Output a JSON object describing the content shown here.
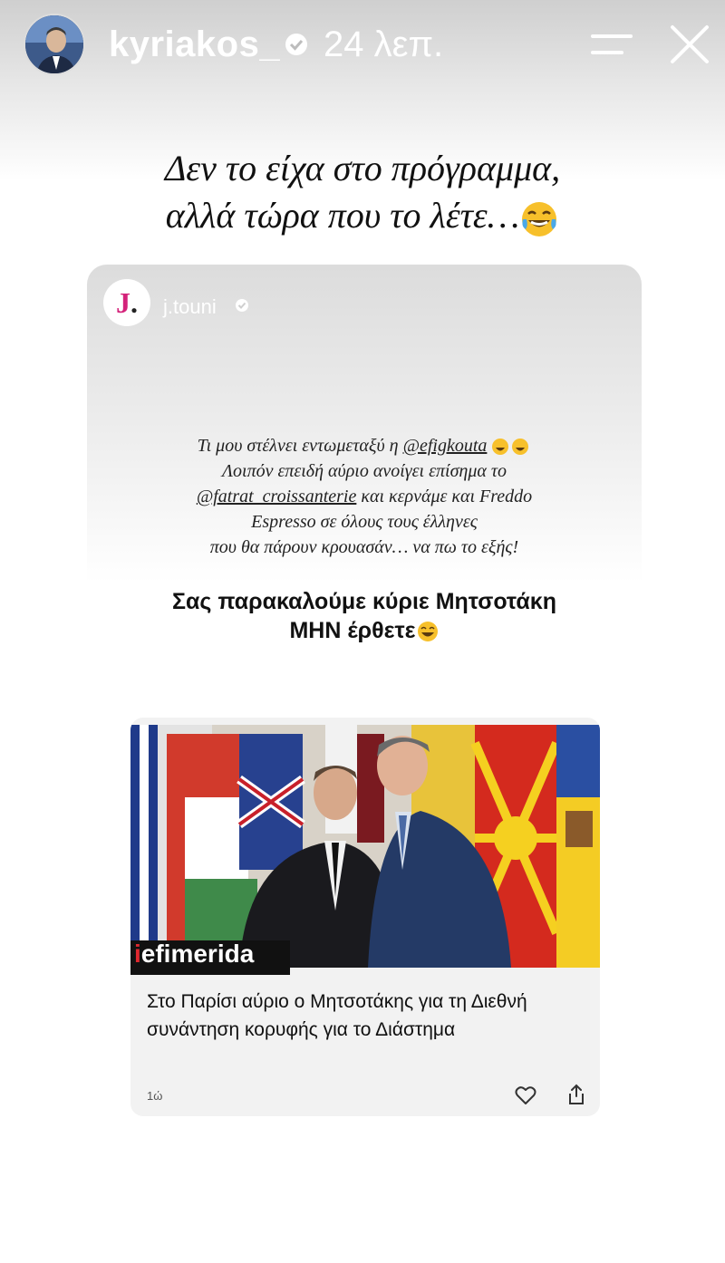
{
  "header": {
    "username": "kyriakos_",
    "time": "24 λεπ."
  },
  "caption": {
    "line1": "Δεν το είχα στο πρόγραμμα,",
    "line2": "αλλά τώρα που το λέτε…",
    "emoji": "face-with-tears-of-joy"
  },
  "repost": {
    "logo_letter": "J",
    "account": "j.touni",
    "text": {
      "l1_a": "Τι μου στέλνει εντωμεταξύ η ",
      "l1_mention": "@efigkouta",
      "l2": "Λοιπόν επειδή αύριο ανοίγει επίσημα το",
      "l3_mention": "@fatrat_croissanterie",
      "l3_b": " και κερνάμε και Freddo",
      "l4": "Espresso σε όλους τους έλληνες",
      "l5": "που θα πάρουν κρουασάν… να πω το εξής!"
    },
    "plea": {
      "line1": "Σας παρακαλούμε κύριε Μητσοτάκη",
      "line2": "ΜΗΝ έρθετε"
    }
  },
  "link_card": {
    "brand_prefix": "i",
    "brand_rest": "efimerida",
    "headline": "Στο Παρίσι αύριο ο Μητσοτάκης για τη Διεθνή συνάντηση κορυφής για το Διάστημα",
    "ago": "1ώ"
  },
  "colors": {
    "j_logo": "#d4237a",
    "brand_red": "#e0282f",
    "emoji_yellow": "#f7c02b"
  }
}
